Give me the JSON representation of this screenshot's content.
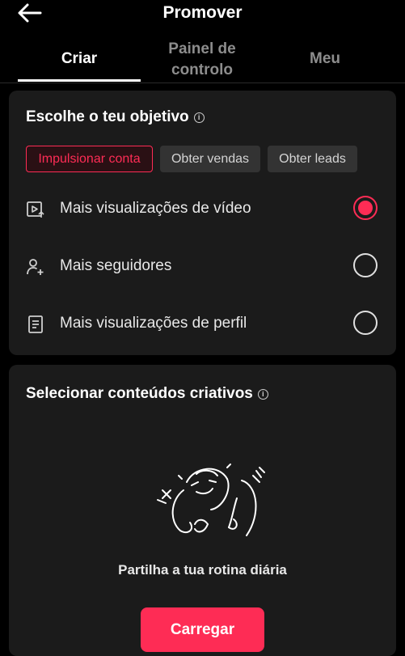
{
  "header": {
    "title": "Promover",
    "back_icon": "arrow-left-icon"
  },
  "tabs": [
    {
      "label": "Criar",
      "active": true
    },
    {
      "label": "Painel de controlo",
      "active": false
    },
    {
      "label": "Meu",
      "active": false
    }
  ],
  "objective": {
    "title": "Escolhe o teu objetivo",
    "info_icon": "info-icon",
    "chips": [
      {
        "label": "Impulsionar conta",
        "selected": true
      },
      {
        "label": "Obter vendas",
        "selected": false
      },
      {
        "label": "Obter leads",
        "selected": false
      }
    ],
    "options": [
      {
        "label": "Mais visualizações de vídeo",
        "icon": "video-play-icon",
        "selected": true
      },
      {
        "label": "Mais seguidores",
        "icon": "add-person-icon",
        "selected": false
      },
      {
        "label": "Mais visualizações de perfil",
        "icon": "profile-document-icon",
        "selected": false
      }
    ]
  },
  "creative": {
    "title": "Selecionar conteúdos criativos",
    "info_icon": "info-icon",
    "empty_text": "Partilha a tua rotina diária",
    "upload_label": "Carregar"
  },
  "colors": {
    "accent": "#fe2c55",
    "background": "#000000",
    "card": "#1b1b1b"
  }
}
